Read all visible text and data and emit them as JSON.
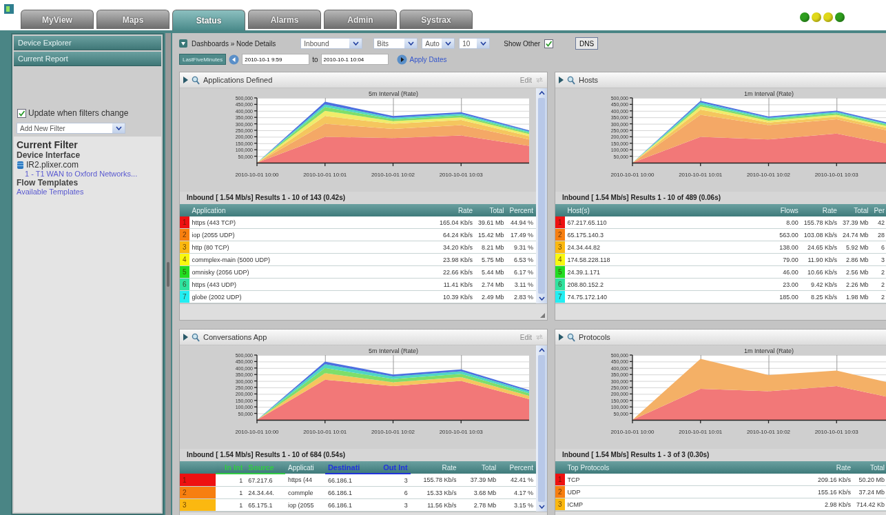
{
  "tabs": [
    {
      "label": "MyView",
      "selected": false
    },
    {
      "label": "Maps",
      "selected": false
    },
    {
      "label": "Status",
      "selected": true
    },
    {
      "label": "Alarms",
      "selected": false
    },
    {
      "label": "Admin",
      "selected": false
    },
    {
      "label": "Systrax",
      "selected": false
    }
  ],
  "status_lights": [
    {
      "color": "#2e9e1e"
    },
    {
      "color": "#e0d81a"
    },
    {
      "color": "#e0d81a"
    },
    {
      "color": "#2e9e1e"
    }
  ],
  "sidebar": {
    "sections": [
      {
        "label": "Device Explorer"
      },
      {
        "label": "Current Report"
      }
    ],
    "update_checkbox": {
      "label": "Update when filters change",
      "checked": true
    },
    "filter_select": {
      "value": "Add New Filter"
    },
    "current_filter": {
      "title": "Current Filter",
      "device_heading": "Device Interface",
      "device": "IR2.plixer.com",
      "interface_link": "1 - T1 WAN to Oxford Networks...",
      "templates_heading": "Flow Templates",
      "templates_link": "Available Templates"
    }
  },
  "toolbar": {
    "breadcrumb": "Dashboards » Node Details",
    "selects": [
      {
        "value": "Inbound"
      },
      {
        "value": "Bits"
      },
      {
        "value": "Auto"
      },
      {
        "value": "10"
      }
    ],
    "show_other": {
      "label": "Show Other",
      "checked": true
    },
    "dns_button": "DNS",
    "range_button": "LastFiveMinutes",
    "start": "2010-10-1 9:59",
    "to_label": "to",
    "end": "2010-10-1 10:04",
    "apply_link": "Apply Dates"
  },
  "panels": [
    {
      "title": "Applications Defined",
      "edit_label": "Edit",
      "scrollbar": true,
      "chart_data": {
        "type": "area",
        "title": "5m Interval (Rate)",
        "stacked": true,
        "grid": true,
        "categories": [
          "2010-10-01 10:00",
          "2010-10-01 10:01",
          "2010-10-01 10:02",
          "2010-10-01 10:03",
          null
        ],
        "ylim": [
          0,
          500000
        ],
        "yticks": [
          {
            "value": 50000,
            "label": "50,000"
          },
          {
            "value": 100000,
            "label": "100,000"
          },
          {
            "value": 150000,
            "label": "150,000"
          },
          {
            "value": 200000,
            "label": "200,000"
          },
          {
            "value": 250000,
            "label": "250,000"
          },
          {
            "value": 300000,
            "label": "300,000"
          },
          {
            "value": 350000,
            "label": "350,000"
          },
          {
            "value": 400000,
            "label": "400,000"
          },
          {
            "value": 450000,
            "label": "450,000"
          },
          {
            "value": 500000,
            "label": "500,000"
          }
        ],
        "series": [
          {
            "color": "#f27878",
            "values": [
              0,
              200000,
              190000,
              210000,
              130000
            ]
          },
          {
            "color": "#f4a866",
            "values": [
              0,
              100000,
              70000,
              80000,
              50000
            ]
          },
          {
            "color": "#f5c65e",
            "values": [
              0,
              60000,
              40000,
              40000,
              25000
            ]
          },
          {
            "color": "#f0ec6a",
            "values": [
              0,
              40000,
              20000,
              20000,
              15000
            ]
          },
          {
            "color": "#7ede6a",
            "values": [
              0,
              30000,
              15000,
              15000,
              12000
            ]
          },
          {
            "color": "#4fd6c4",
            "values": [
              0,
              20000,
              12000,
              12000,
              10000
            ]
          },
          {
            "color": "#4b6fe0",
            "values": [
              0,
              20000,
              13000,
              13000,
              8000
            ]
          }
        ]
      },
      "summary": "Inbound [ 1.54 Mb/s] Results 1 - 10 of 143 (0.42s)",
      "columns": [
        {
          "label": "Application",
          "kind": "text"
        },
        {
          "label": "Rate",
          "kind": "number"
        },
        {
          "label": "Total",
          "kind": "number"
        },
        {
          "label": "Percent",
          "kind": "number"
        }
      ],
      "rows": [
        {
          "rank": "1",
          "color": "#ee1111",
          "cells": [
            "https (443 TCP)",
            "165.04 Kb/s",
            "39.61 Mb",
            "44.94 %"
          ]
        },
        {
          "rank": "2",
          "color": "#f77f10",
          "cells": [
            "iop (2055 UDP)",
            "64.24 Kb/s",
            "15.42 Mb",
            "17.49 %"
          ]
        },
        {
          "rank": "3",
          "color": "#fbb810",
          "cells": [
            "http (80 TCP)",
            "34.20 Kb/s",
            "8.21 Mb",
            "9.31 %"
          ]
        },
        {
          "rank": "4",
          "color": "#f8f810",
          "cells": [
            "commplex-main (5000 UDP)",
            "23.98 Kb/s",
            "5.75 Mb",
            "6.53 %"
          ]
        },
        {
          "rank": "5",
          "color": "#22dd22",
          "cells": [
            "omnisky (2056 UDP)",
            "22.66 Kb/s",
            "5.44 Mb",
            "6.17 %"
          ]
        },
        {
          "rank": "6",
          "color": "#2fe3a0",
          "cells": [
            "https (443 UDP)",
            "11.41 Kb/s",
            "2.74 Mb",
            "3.11 %"
          ]
        },
        {
          "rank": "7",
          "color": "#22eef2",
          "cells": [
            "globe (2002 UDP)",
            "10.39 Kb/s",
            "2.49 Mb",
            "2.83 %"
          ]
        }
      ]
    },
    {
      "title": "Hosts",
      "scrollbar": false,
      "chart_data": {
        "type": "area",
        "title": "1m Interval (Rate)",
        "stacked": true,
        "grid": true,
        "categories": [
          "2010-10-01 10:00",
          "2010-10-01 10:01",
          "2010-10-01 10:02",
          "2010-10-01 10:03",
          null
        ],
        "ylim": [
          0,
          500000
        ],
        "yticks": [
          {
            "value": 50000,
            "label": "50,000"
          },
          {
            "value": 100000,
            "label": "100,000"
          },
          {
            "value": 150000,
            "label": "150,000"
          },
          {
            "value": 200000,
            "label": "200,000"
          },
          {
            "value": 250000,
            "label": "250,000"
          },
          {
            "value": 300000,
            "label": "300,000"
          },
          {
            "value": 350000,
            "label": "350,000"
          },
          {
            "value": 400000,
            "label": "400,000"
          },
          {
            "value": 450000,
            "label": "450,000"
          },
          {
            "value": 500000,
            "label": "500,000"
          }
        ],
        "series": [
          {
            "color": "#f27878",
            "values": [
              0,
              200000,
              180000,
              225000,
              120000
            ]
          },
          {
            "color": "#f4a866",
            "values": [
              0,
              170000,
              110000,
              110000,
              100000
            ]
          },
          {
            "color": "#f5c65e",
            "values": [
              0,
              40000,
              20000,
              20000,
              20000
            ]
          },
          {
            "color": "#f0ec6a",
            "values": [
              0,
              25000,
              15000,
              15000,
              12000
            ]
          },
          {
            "color": "#7ede6a",
            "values": [
              0,
              15000,
              12000,
              12000,
              10000
            ]
          },
          {
            "color": "#4fd6c4",
            "values": [
              0,
              15000,
              10000,
              10000,
              8000
            ]
          },
          {
            "color": "#4b6fe0",
            "values": [
              0,
              12000,
              10000,
              10000,
              8000
            ]
          }
        ]
      },
      "summary": "Inbound [ 1.54 Mb/s] Results 1 - 10 of 489 (0.06s)",
      "columns": [
        {
          "label": "Host(s)",
          "kind": "text"
        },
        {
          "label": "Flows",
          "kind": "number"
        },
        {
          "label": "Rate",
          "kind": "number"
        },
        {
          "label": "Total",
          "kind": "number"
        },
        {
          "label": "Per",
          "kind": "number"
        }
      ],
      "rows": [
        {
          "rank": "1",
          "color": "#ee1111",
          "cells": [
            "67.217.65.110",
            "8.00",
            "155.78 Kb/s",
            "37.39 Mb",
            "42"
          ]
        },
        {
          "rank": "2",
          "color": "#f77f10",
          "cells": [
            "65.175.140.3",
            "563.00",
            "103.08 Kb/s",
            "24.74 Mb",
            "28"
          ]
        },
        {
          "rank": "3",
          "color": "#fbb810",
          "cells": [
            "24.34.44.82",
            "138.00",
            "24.65 Kb/s",
            "5.92 Mb",
            "6"
          ]
        },
        {
          "rank": "4",
          "color": "#f8f810",
          "cells": [
            "174.58.228.118",
            "79.00",
            "11.90 Kb/s",
            "2.86 Mb",
            "3"
          ]
        },
        {
          "rank": "5",
          "color": "#22dd22",
          "cells": [
            "24.39.1.171",
            "46.00",
            "10.66 Kb/s",
            "2.56 Mb",
            "2"
          ]
        },
        {
          "rank": "6",
          "color": "#2fe3a0",
          "cells": [
            "208.80.152.2",
            "23.00",
            "9.42 Kb/s",
            "2.26 Mb",
            "2"
          ]
        },
        {
          "rank": "7",
          "color": "#22eef2",
          "cells": [
            "74.75.172.140",
            "185.00",
            "8.25 Kb/s",
            "1.98 Mb",
            "2"
          ]
        }
      ]
    },
    {
      "title": "Conversations App",
      "edit_label": "Edit",
      "scrollbar": true,
      "chart_data": {
        "type": "area",
        "title": "5m Interval (Rate)",
        "stacked": true,
        "grid": true,
        "categories": [
          "2010-10-01 10:00",
          "2010-10-01 10:01",
          "2010-10-01 10:02",
          "2010-10-01 10:03",
          null
        ],
        "ylim": [
          0,
          500000
        ],
        "yticks": [
          {
            "value": 50000,
            "label": "50,000"
          },
          {
            "value": 100000,
            "label": "100,000"
          },
          {
            "value": 150000,
            "label": "150,000"
          },
          {
            "value": 200000,
            "label": "200,000"
          },
          {
            "value": 250000,
            "label": "250,000"
          },
          {
            "value": 300000,
            "label": "300,000"
          },
          {
            "value": 350000,
            "label": "350,000"
          },
          {
            "value": 400000,
            "label": "400,000"
          },
          {
            "value": 450000,
            "label": "450,000"
          },
          {
            "value": 500000,
            "label": "500,000"
          }
        ],
        "series": [
          {
            "color": "#f27878",
            "values": [
              0,
              310000,
              260000,
              300000,
              160000
            ]
          },
          {
            "color": "#f5c65e",
            "values": [
              0,
              50000,
              30000,
              30000,
              25000
            ]
          },
          {
            "color": "#7ede6a",
            "values": [
              0,
              40000,
              25000,
              25000,
              20000
            ]
          },
          {
            "color": "#4fd6c4",
            "values": [
              0,
              30000,
              20000,
              20000,
              15000
            ]
          },
          {
            "color": "#4b6fe0",
            "values": [
              0,
              20000,
              15000,
              15000,
              10000
            ]
          }
        ]
      },
      "summary": "Inbound [ 1.54 Mb/s] Results 1 - 10 of 684 (0.54s)",
      "columns": [
        {
          "label": "In Int",
          "kind": "number",
          "color": "#33cc44"
        },
        {
          "label": "Source",
          "kind": "text",
          "color": "#33cc44"
        },
        {
          "label": "Applicati",
          "kind": "text"
        },
        {
          "label": "Destinati",
          "kind": "text",
          "color": "#2233dd"
        },
        {
          "label": "Out Int",
          "kind": "number",
          "color": "#2233dd"
        },
        {
          "label": "Rate",
          "kind": "number"
        },
        {
          "label": "Total",
          "kind": "number"
        },
        {
          "label": "Percent",
          "kind": "number"
        }
      ],
      "rows": [
        {
          "rank": "1",
          "color": "#ee1111",
          "cells": [
            "1",
            "67.217.6",
            "https (44",
            "66.186.1",
            "3",
            "155.78 Kb/s",
            "37.39 Mb",
            "42.41 %"
          ]
        },
        {
          "rank": "2",
          "color": "#f77f10",
          "cells": [
            "1",
            "24.34.44.",
            "commple",
            "66.186.1",
            "6",
            "15.33 Kb/s",
            "3.68 Mb",
            "4.17 %"
          ]
        },
        {
          "rank": "3",
          "color": "#fbb810",
          "cells": [
            "1",
            "65.175.1",
            "iop (2055",
            "66.186.1",
            "3",
            "11.56 Kb/s",
            "2.78 Mb",
            "3.15 %"
          ]
        }
      ]
    },
    {
      "title": "Protocols",
      "scrollbar": false,
      "chart_data": {
        "type": "area",
        "title": "1m Interval (Rate)",
        "stacked": true,
        "grid": true,
        "categories": [
          "2010-10-01 10:00",
          "2010-10-01 10:01",
          "2010-10-01 10:02",
          "2010-10-01 10:03",
          null
        ],
        "ylim": [
          0,
          500000
        ],
        "yticks": [
          {
            "value": 50000,
            "label": "50,000"
          },
          {
            "value": 100000,
            "label": "100,000"
          },
          {
            "value": 150000,
            "label": "150,000"
          },
          {
            "value": 200000,
            "label": "200,000"
          },
          {
            "value": 250000,
            "label": "250,000"
          },
          {
            "value": 300000,
            "label": "300,000"
          },
          {
            "value": 350000,
            "label": "350,000"
          },
          {
            "value": 400000,
            "label": "400,000"
          },
          {
            "value": 450000,
            "label": "450,000"
          },
          {
            "value": 500000,
            "label": "500,000"
          }
        ],
        "series": [
          {
            "color": "#f27878",
            "values": [
              0,
              240000,
              220000,
              260000,
              150000
            ]
          },
          {
            "color": "#f4b066",
            "values": [
              0,
              230000,
              125000,
              120000,
              110000
            ]
          }
        ]
      },
      "summary": "Inbound [ 1.54 Mb/s] Results 1 - 3 of 3 (0.30s)",
      "columns": [
        {
          "label": "Top Protocols",
          "kind": "text"
        },
        {
          "label": "Rate",
          "kind": "number"
        },
        {
          "label": "Total",
          "kind": "number"
        }
      ],
      "rows": [
        {
          "rank": "1",
          "color": "#ee1111",
          "cells": [
            "TCP",
            "209.16 Kb/s",
            "50.20 Mb"
          ]
        },
        {
          "rank": "2",
          "color": "#f77f10",
          "cells": [
            "UDP",
            "155.16 Kb/s",
            "37.24 Mb"
          ]
        },
        {
          "rank": "3",
          "color": "#fbb810",
          "cells": [
            "ICMP",
            "2.98 Kb/s",
            "714.42 Kb"
          ]
        }
      ]
    }
  ]
}
